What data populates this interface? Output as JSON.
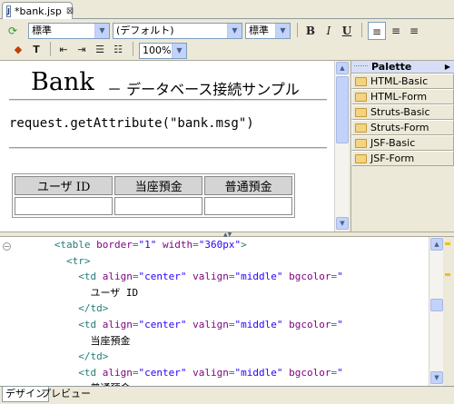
{
  "editor_tab": {
    "icon": "J",
    "title": "*bank.jsp",
    "close": "⊠"
  },
  "toolbar": {
    "style_select": "標準",
    "font_select": "(デフォルト)",
    "size_select": "標準",
    "bold": "B",
    "italic": "I",
    "underline": "U",
    "zoom_select": "100%"
  },
  "design": {
    "title": "Bank",
    "subtitle": "－ データベース接続サンプル",
    "request_line": "request.getAttribute(\"bank.msg\")",
    "table_headers": [
      "ユーザ ID",
      "当座預金",
      "普通預金"
    ]
  },
  "palette": {
    "title": "Palette",
    "items": [
      "HTML-Basic",
      "HTML-Form",
      "Struts-Basic",
      "Struts-Form",
      "JSF-Basic",
      "JSF-Form"
    ]
  },
  "source": {
    "lines": [
      {
        "indent": "      ",
        "parts": [
          [
            "tag",
            "<table "
          ],
          [
            "attr",
            "border"
          ],
          [
            "tag",
            "="
          ],
          [
            "val",
            "\"1\""
          ],
          [
            "tag",
            " "
          ],
          [
            "attr",
            "width"
          ],
          [
            "tag",
            "="
          ],
          [
            "val",
            "\"360px\""
          ],
          [
            "tag",
            ">"
          ]
        ]
      },
      {
        "indent": "        ",
        "parts": [
          [
            "tag",
            "<tr>"
          ]
        ]
      },
      {
        "indent": "          ",
        "parts": [
          [
            "tag",
            "<td "
          ],
          [
            "attr",
            "align"
          ],
          [
            "tag",
            "="
          ],
          [
            "val",
            "\"center\""
          ],
          [
            "tag",
            " "
          ],
          [
            "attr",
            "valign"
          ],
          [
            "tag",
            "="
          ],
          [
            "val",
            "\"middle\""
          ],
          [
            "tag",
            " "
          ],
          [
            "attr",
            "bgcolor"
          ],
          [
            "tag",
            "="
          ],
          [
            "val",
            "\""
          ]
        ]
      },
      {
        "indent": "            ",
        "parts": [
          [
            "txt",
            "ユーザ ID"
          ]
        ]
      },
      {
        "indent": "          ",
        "parts": [
          [
            "tag",
            "</td>"
          ]
        ]
      },
      {
        "indent": "          ",
        "parts": [
          [
            "tag",
            "<td "
          ],
          [
            "attr",
            "align"
          ],
          [
            "tag",
            "="
          ],
          [
            "val",
            "\"center\""
          ],
          [
            "tag",
            " "
          ],
          [
            "attr",
            "valign"
          ],
          [
            "tag",
            "="
          ],
          [
            "val",
            "\"middle\""
          ],
          [
            "tag",
            " "
          ],
          [
            "attr",
            "bgcolor"
          ],
          [
            "tag",
            "="
          ],
          [
            "val",
            "\""
          ]
        ]
      },
      {
        "indent": "            ",
        "parts": [
          [
            "txt",
            "当座預金"
          ]
        ]
      },
      {
        "indent": "          ",
        "parts": [
          [
            "tag",
            "</td>"
          ]
        ]
      },
      {
        "indent": "          ",
        "parts": [
          [
            "tag",
            "<td "
          ],
          [
            "attr",
            "align"
          ],
          [
            "tag",
            "="
          ],
          [
            "val",
            "\"center\""
          ],
          [
            "tag",
            " "
          ],
          [
            "attr",
            "valign"
          ],
          [
            "tag",
            "="
          ],
          [
            "val",
            "\"middle\""
          ],
          [
            "tag",
            " "
          ],
          [
            "attr",
            "bgcolor"
          ],
          [
            "tag",
            "="
          ],
          [
            "val",
            "\""
          ]
        ]
      },
      {
        "indent": "            ",
        "parts": [
          [
            "txt",
            "普通預金"
          ]
        ]
      }
    ]
  },
  "bottom_tabs": [
    "デザイン",
    "プレビュー"
  ],
  "colors": {
    "tag": "#237b7b",
    "attribute": "#7f007f",
    "value": "#2a00ff",
    "palette_folder": "#f4d483"
  }
}
